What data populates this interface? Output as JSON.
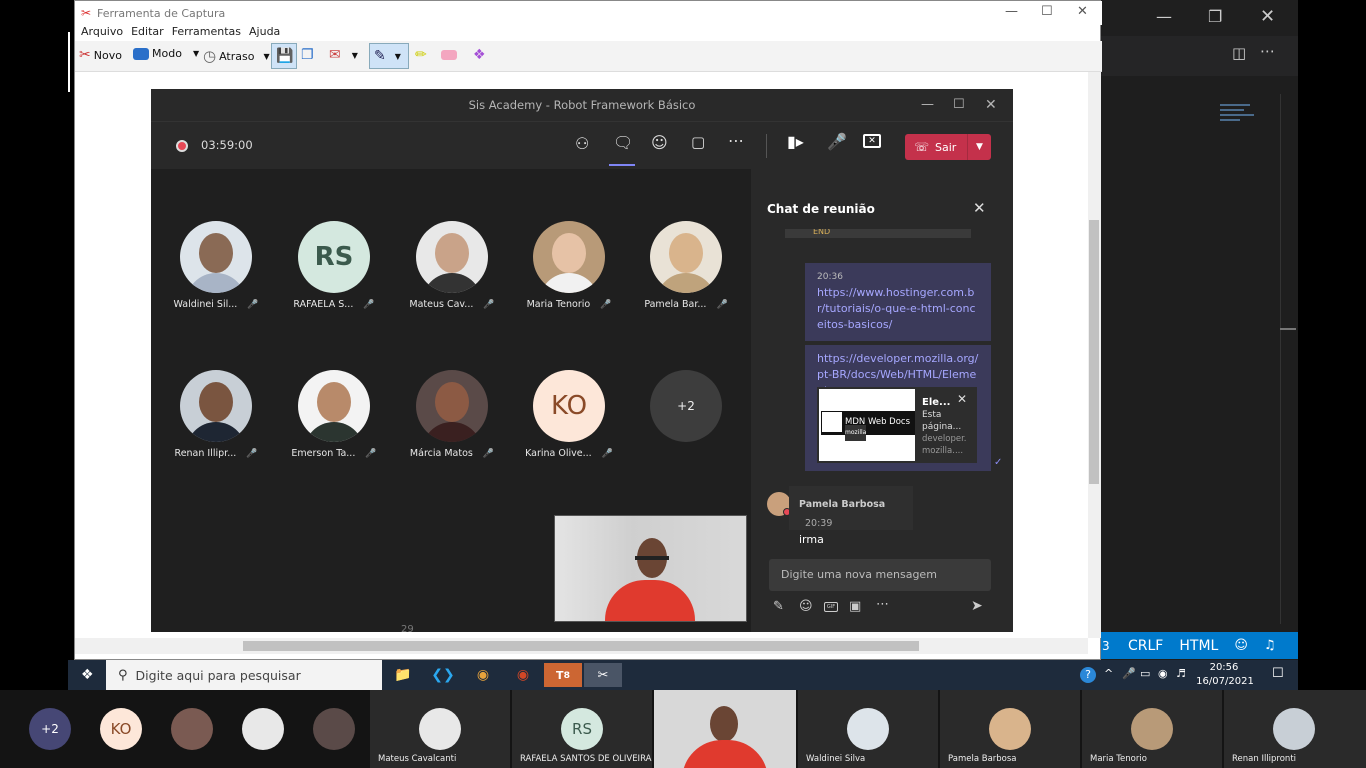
{
  "snipping_tool": {
    "title": "Ferramenta de Captura",
    "menu": [
      "Arquivo",
      "Editar",
      "Ferramentas",
      "Ajuda"
    ],
    "toolbar": {
      "new": "Novo",
      "mode": "Modo",
      "delay": "Atraso"
    }
  },
  "teams": {
    "title": "Sis Academy - Robot Framework Básico",
    "timer": "03:59:00",
    "leave": "Sair",
    "participants": [
      {
        "name": "Waldinei Sil...",
        "initials": ""
      },
      {
        "name": "RAFAELA S...",
        "initials": "RS"
      },
      {
        "name": "Mateus Cav...",
        "initials": ""
      },
      {
        "name": "Maria Tenorio",
        "initials": ""
      },
      {
        "name": "Pamela Bar...",
        "initials": ""
      },
      {
        "name": "Renan Illipr...",
        "initials": ""
      },
      {
        "name": "Emerson Ta...",
        "initials": ""
      },
      {
        "name": "Márcia Matos",
        "initials": ""
      },
      {
        "name": "Karina Olive...",
        "initials": "KO"
      },
      {
        "name": "",
        "initials": "+2"
      }
    ],
    "chat": {
      "title": "Chat de reunião",
      "partial_text": "END",
      "msg1_time": "20:36",
      "msg1_link": "https://www.hostinger.com.br/tutoriais/o-que-e-html-conceitos-basicos/",
      "msg2_link": "https://developer.mozilla.org/pt-BR/docs/Web/HTML/Element",
      "preview_image_text": "MDN Web Docs",
      "preview_image_sub": "mozilla",
      "preview_title": "Ele...",
      "preview_desc": "Esta página...",
      "preview_domain": "developer.mozilla....",
      "msg3_author": "Pamela Barbosa",
      "msg3_time": "20:39",
      "msg3_text": "irma",
      "input_placeholder": "Digite uma nova mensagem"
    },
    "stage_number": "29"
  },
  "vscode": {
    "status": [
      "CRLF",
      "HTML"
    ]
  },
  "taskbar": {
    "search_placeholder": "Digite aqui para pesquisar",
    "time": "20:56",
    "date": "16/07/2021",
    "teams_badge": "8"
  },
  "bottom_strip": {
    "more": "+2",
    "ko": "KO",
    "tiles": [
      {
        "name": "Mateus Cavalcanti"
      },
      {
        "name": "RAFAELA SANTOS DE OLIVEIRA SO...",
        "initials": "RS"
      },
      {
        "name": ""
      },
      {
        "name": "Waldinei Silva"
      },
      {
        "name": "Pamela Barbosa"
      },
      {
        "name": "Maria Tenorio"
      },
      {
        "name": "Renan Illipronti"
      }
    ]
  },
  "colors": {
    "teams_accent": "#6264a7",
    "leave_red": "#c4314b",
    "vscode_blue": "#007acc"
  }
}
